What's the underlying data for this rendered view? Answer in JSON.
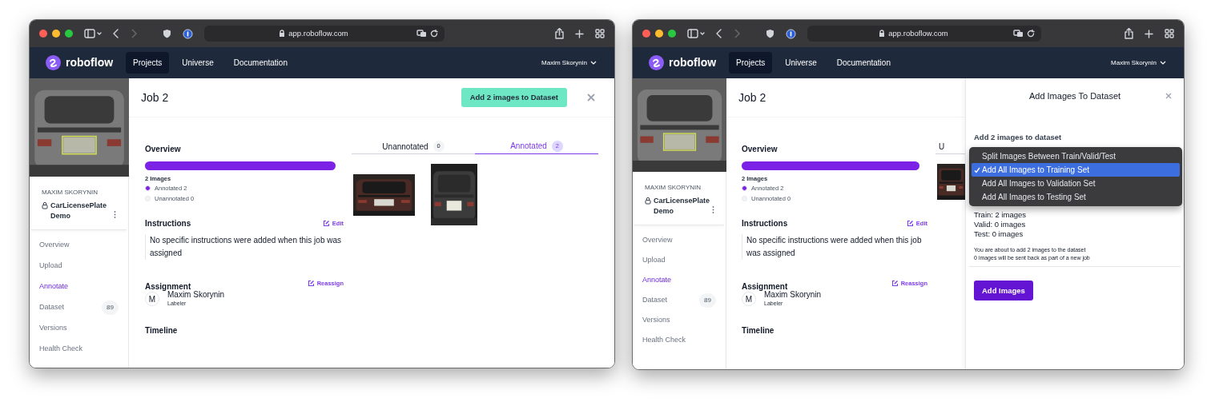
{
  "windows": [
    {
      "kind": "job",
      "address": "app.roboflow.com",
      "nav": {
        "brand": "roboflow",
        "links": [
          {
            "label": "Projects",
            "selected": true
          },
          {
            "label": "Universe",
            "selected": false
          },
          {
            "label": "Documentation",
            "selected": false
          }
        ],
        "user": "Maxim Skorynin"
      },
      "sidebar": {
        "owner": "MAXIM SKORYNIN",
        "project": "CarLicensePlate Demo",
        "items": [
          {
            "label": "Overview",
            "selected": false
          },
          {
            "label": "Upload",
            "selected": false
          },
          {
            "label": "Annotate",
            "selected": true
          },
          {
            "label": "Dataset",
            "selected": false,
            "count": "89"
          },
          {
            "label": "Versions",
            "selected": false
          },
          {
            "label": "Health Check",
            "selected": false
          }
        ]
      },
      "job": {
        "title": "Job 2",
        "action_button": "Add 2 images to Dataset",
        "overview": {
          "heading": "Overview",
          "level": 1,
          "count": "2 Images",
          "legend": [
            {
              "label": "Annotated 2",
              "color": "#7c22e6"
            },
            {
              "label": "Unannotated 0",
              "color": "#f3f4f6"
            }
          ]
        },
        "instructions": {
          "heading": "Instructions",
          "edit": "Edit",
          "text": "No specific instructions were added when this job was assigned"
        },
        "assignment": {
          "heading": "Assignment",
          "avatar": "M",
          "name": "Maxim Skorynin",
          "role": "Labeler",
          "reassign": "Reassign"
        },
        "timeline": "Timeline",
        "tabs": [
          {
            "label": "Unannotated",
            "count": "0",
            "selected": false
          },
          {
            "label": "Annotated",
            "count": "2",
            "selected": true
          }
        ]
      }
    },
    {
      "kind": "job_with_drawer",
      "address": "app.roboflow.com",
      "nav": {
        "brand": "roboflow",
        "links": [
          {
            "label": "Projects",
            "selected": true
          },
          {
            "label": "Universe",
            "selected": false
          },
          {
            "label": "Documentation",
            "selected": false
          }
        ],
        "user": "Maxim Skorynin"
      },
      "sidebar": {
        "owner": "MAXIM SKORYNIN",
        "project": "CarLicensePlate Demo",
        "items": [
          {
            "label": "Overview",
            "selected": false
          },
          {
            "label": "Upload",
            "selected": false
          },
          {
            "label": "Annotate",
            "selected": true
          },
          {
            "label": "Dataset",
            "selected": false,
            "count": "89"
          },
          {
            "label": "Versions",
            "selected": false
          },
          {
            "label": "Health Check",
            "selected": false
          }
        ]
      },
      "job": {
        "title": "Job 2",
        "overview": {
          "heading": "Overview",
          "level": 1,
          "count": "2 Images",
          "legend": [
            {
              "label": "Annotated 2",
              "color": "#7c22e6"
            },
            {
              "label": "Unannotated 0",
              "color": "#f3f4f6"
            }
          ]
        },
        "instructions": {
          "heading": "Instructions",
          "edit": "Edit",
          "text": "No specific instructions were added when this job was assigned"
        },
        "assignment": {
          "heading": "Assignment",
          "avatar": "M",
          "name": "Maxim Skorynin",
          "role": "Labeler",
          "reassign": "Reassign"
        },
        "timeline": "Timeline",
        "tabs": [
          {
            "label": "U",
            "selected": false
          }
        ]
      },
      "drawer": {
        "title": "Add Images To Dataset",
        "subheading": "Add 2 images to dataset",
        "menu": [
          {
            "label": "Split Images Between Train/Valid/Test",
            "selected": false
          },
          {
            "label": "Add All Images to Training Set",
            "selected": true
          },
          {
            "label": "Add All Images to Validation Set",
            "selected": false
          },
          {
            "label": "Add All Images to Testing Set",
            "selected": false
          }
        ],
        "distribution": [
          "Train: 2 images",
          "Valid: 0 images",
          "Test: 0 images"
        ],
        "notes": [
          "You are about to add 2 images to the dataset",
          "0 images will be sent back as part of a new job"
        ],
        "button": "Add Images"
      }
    }
  ]
}
